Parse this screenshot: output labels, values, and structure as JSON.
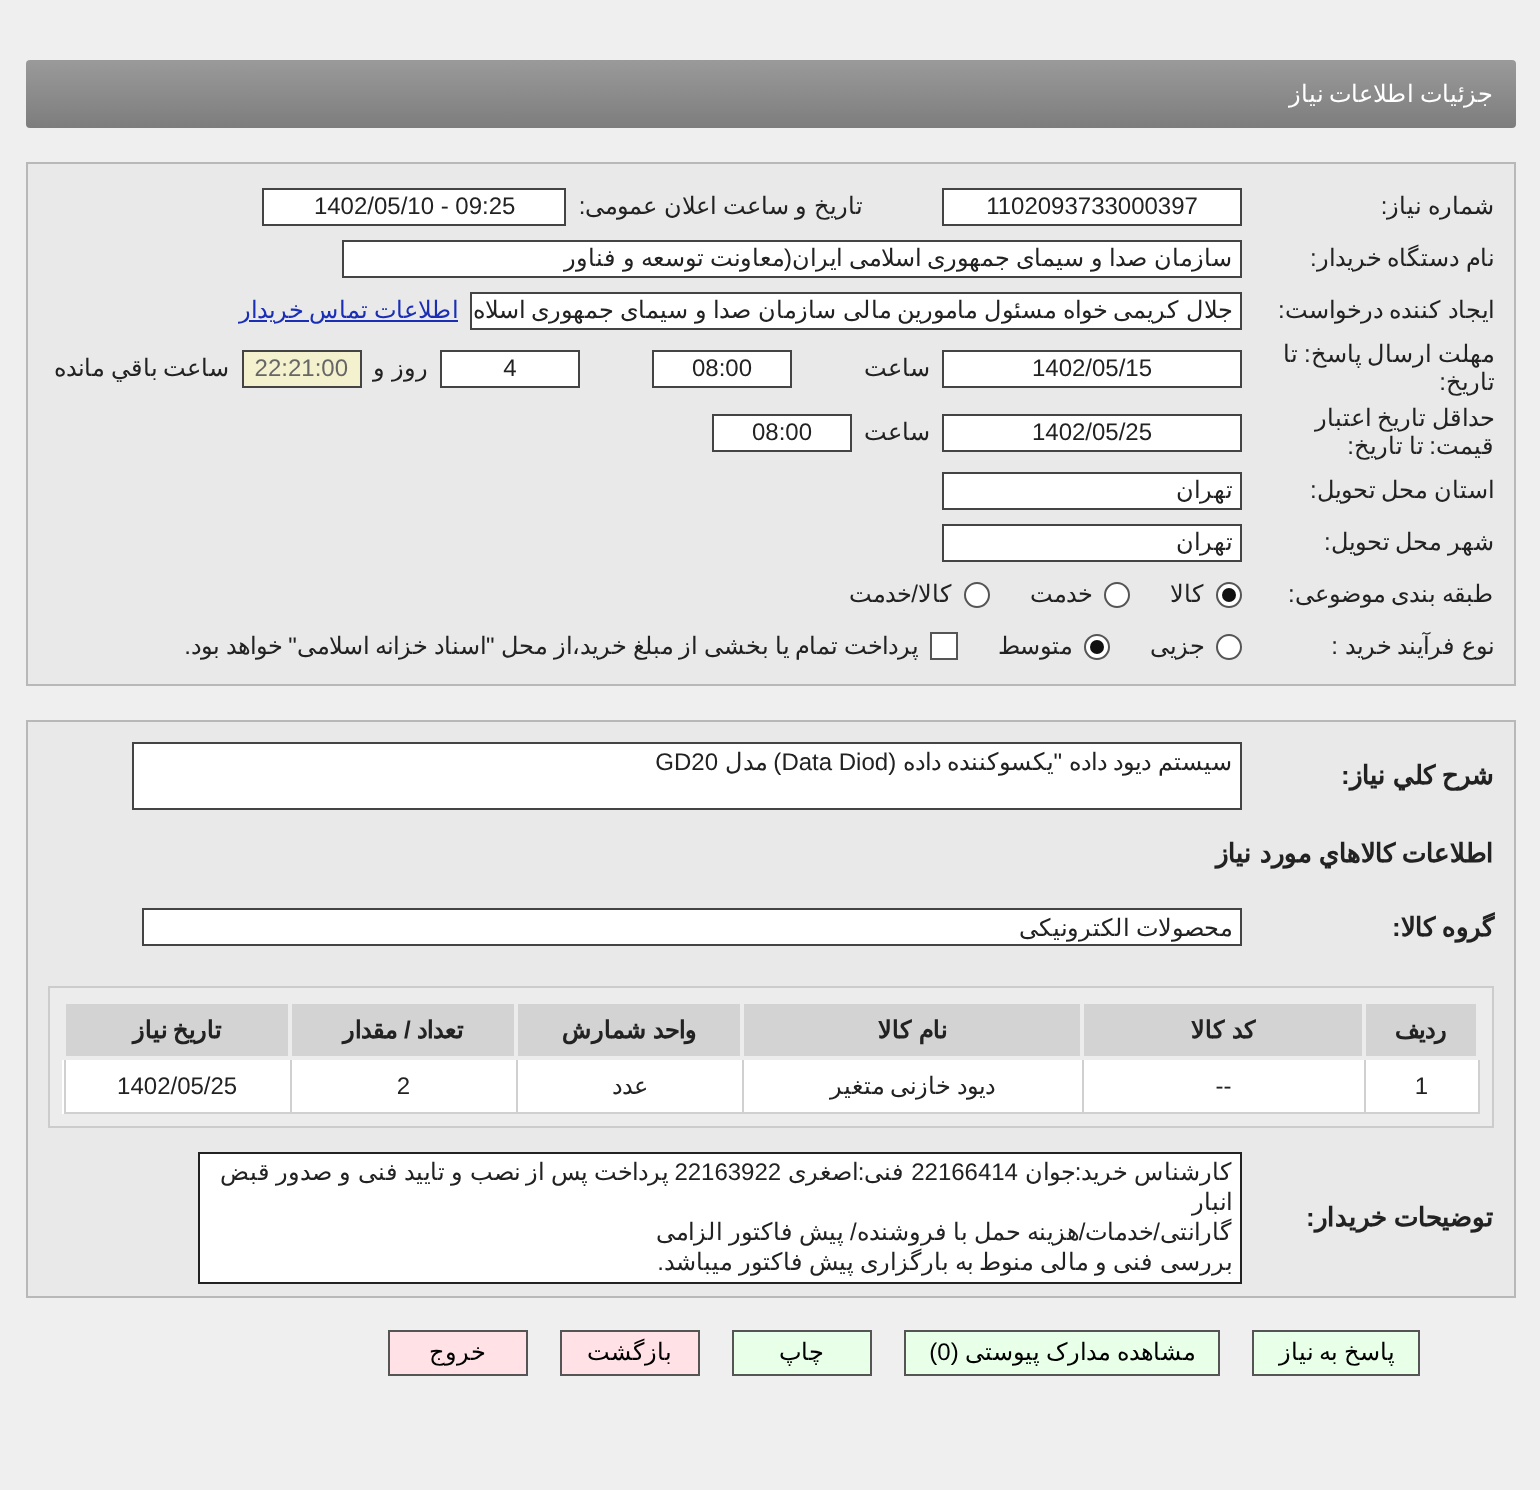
{
  "header": {
    "title": "جزئیات اطلاعات نیاز"
  },
  "need_number": {
    "label": "شماره نیاز:",
    "value": "1102093733000397"
  },
  "announce": {
    "label": "تاریخ و ساعت اعلان عمومی:",
    "value": "1402/05/10 - 09:25"
  },
  "buyer_org": {
    "label": "نام دستگاه خریدار:",
    "value": "سازمان صدا و سیمای جمهوری اسلامی ایران(معاونت توسعه و فناور"
  },
  "requester": {
    "label": "ایجاد کننده درخواست:",
    "value": "جلال کریمی خواه مسئول مامورین مالی  سازمان صدا و سیمای جمهوری اسلاه",
    "link": "اطلاعات تماس خریدار"
  },
  "reply_deadline": {
    "label": "مهلت ارسال پاسخ: تا تاریخ:",
    "date": "1402/05/15",
    "time_label": "ساعت",
    "time": "08:00",
    "days": "4",
    "days_label": "روز و",
    "remaining": "22:21:00",
    "remaining_label": "ساعت باقي مانده"
  },
  "price_validity": {
    "label": "حداقل تاریخ اعتبار قیمت: تا تاریخ:",
    "date": "1402/05/25",
    "time_label": "ساعت",
    "time": "08:00"
  },
  "province": {
    "label": "استان محل تحویل:",
    "value": "تهران"
  },
  "city": {
    "label": "شهر محل تحویل:",
    "value": "تهران"
  },
  "category": {
    "label": "طبقه بندی موضوعی:",
    "options": [
      {
        "label": "کالا",
        "selected": true
      },
      {
        "label": "خدمت",
        "selected": false
      },
      {
        "label": "کالا/خدمت",
        "selected": false
      }
    ]
  },
  "process": {
    "label": "نوع فرآیند خرید :",
    "options": [
      {
        "label": "جزیی",
        "selected": false
      },
      {
        "label": "متوسط",
        "selected": true
      }
    ],
    "payment": {
      "checked": false,
      "label": "پرداخت تمام یا بخشی از مبلغ خرید،از محل \"اسناد خزانه اسلامی\" خواهد بود."
    }
  },
  "summary": {
    "label": "شرح کلي نیاز:",
    "value": "سیستم دیود داده  \"یکسوکننده داده (Data Diod)  مدل GD20"
  },
  "items_heading": "اطلاعات کالاهاي مورد نیاز",
  "goods_group": {
    "label": "گروه کالا:",
    "value": "محصولات الکترونیکی"
  },
  "table": {
    "columns": [
      "ردیف",
      "کد کالا",
      "نام کالا",
      "واحد شمارش",
      "تعداد / مقدار",
      "تاریخ نیاز"
    ],
    "rows": [
      [
        "1",
        "--",
        "دیود خازنی متغیر",
        "عدد",
        "2",
        "1402/05/25"
      ]
    ]
  },
  "buyer_notes": {
    "label": "توضیحات خریدار:",
    "lines": [
      "کارشناس خرید:جوان 22166414  فنی:اصغری 22163922  پرداخت پس از نصب و تایید فنی و صدور قبض انبار",
      "گارانتی/خدمات/هزینه حمل با فروشنده/ پیش فاکتور الزامی",
      "بررسی فنی و مالی منوط به بارگزاری پیش فاکتور میباشد."
    ]
  },
  "buttons": [
    {
      "label": "پاسخ به نیاز",
      "kind": "normal"
    },
    {
      "label": "مشاهده مدارک پیوستی (0)",
      "kind": "normal"
    },
    {
      "label": "چاپ",
      "kind": "normal"
    },
    {
      "label": "بازگشت",
      "kind": "exit"
    },
    {
      "label": "خروج",
      "kind": "exit"
    }
  ]
}
